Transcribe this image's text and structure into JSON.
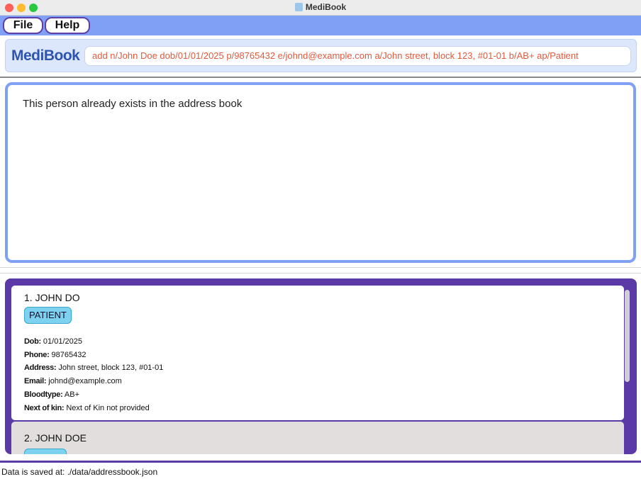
{
  "window": {
    "title": "MediBook"
  },
  "menu": {
    "file": "File",
    "help": "Help"
  },
  "command": {
    "brand": "MediBook",
    "text": "add n/John Doe dob/01/01/2025 p/98765432 e/johnd@example.com a/John street, block 123, #01-01 b/AB+ ap/Patient"
  },
  "result": {
    "message": "This person already exists in the address book"
  },
  "persons": [
    {
      "index": "1.",
      "name": "JOHN DO",
      "tag": "PATIENT",
      "fields": [
        {
          "label": "Dob:",
          "value": "01/01/2025"
        },
        {
          "label": "Phone:",
          "value": "98765432"
        },
        {
          "label": "Address:",
          "value": "John street, block 123, #01-01"
        },
        {
          "label": "Email:",
          "value": "johnd@example.com"
        },
        {
          "label": "Bloodtype:",
          "value": "AB+"
        },
        {
          "label": "Next of kin:",
          "value": "Next of Kin not provided"
        }
      ]
    },
    {
      "index": "2.",
      "name": "JOHN DOE"
    }
  ],
  "status": {
    "text": "Data is saved at: ./data/addressbook.json"
  },
  "colors": {
    "accent": "#7fa0f5",
    "list_bg": "#5b3aa8",
    "command_text": "#e05a3f",
    "brand": "#2d55b0"
  }
}
